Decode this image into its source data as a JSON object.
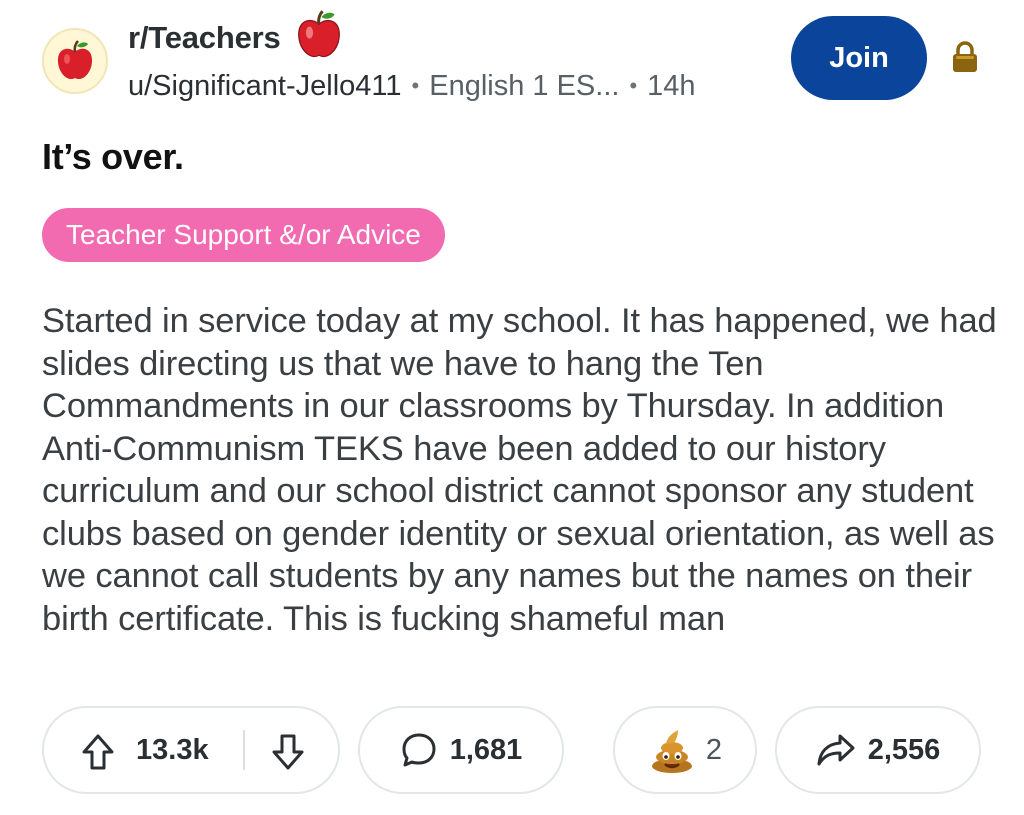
{
  "post": {
    "subreddit": "r/Teachers",
    "author": "u/Significant-Jello411",
    "user_flair": "English 1 ES...",
    "time_ago": "14h",
    "join_label": "Join",
    "title": "It’s over.",
    "flair": "Teacher Support &/or Advice",
    "body": "Started in service today at my school. It has happened, we had slides directing us that we have to hang the Ten Commandments in our classrooms by Thursday. In addition Anti-Communism TEKS have been added to our history curriculum and our school district cannot sponsor any student clubs based on gender identity or sexual orientation, as well as we cannot call students by any names but the names on their birth certificate. This is fucking shameful man"
  },
  "actions": {
    "upvotes": "13.3k",
    "comments": "1,681",
    "awards": "2",
    "shares": "2,556"
  },
  "icons": {
    "subreddit_avatar": "apple-icon",
    "subreddit_badge": "apple-icon",
    "lock": "lock-icon",
    "upvote": "upvote-arrow-icon",
    "downvote": "downvote-arrow-icon",
    "comment": "comment-bubble-icon",
    "award": "poop-award-icon",
    "share": "share-arrow-icon"
  },
  "colors": {
    "join_button": "#0a449b",
    "flair_background": "#f26bb1",
    "apple_red": "#d9202a",
    "lock_gold": "#8a6410"
  }
}
